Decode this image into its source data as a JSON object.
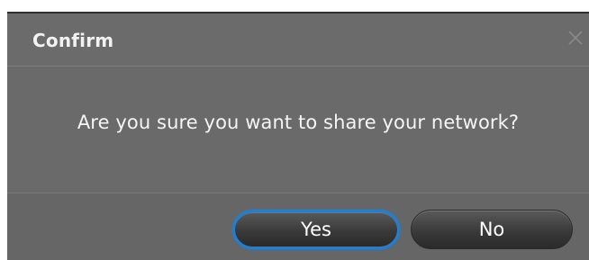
{
  "dialog": {
    "title": "Confirm",
    "close_icon": "close-icon",
    "message": "Are you sure you want to share your network?",
    "buttons": {
      "yes_label": "Yes",
      "no_label": "No"
    },
    "colors": {
      "background": "#6e6e6e",
      "focus_ring": "#1f7fd4",
      "button": "#3a3a3a",
      "text": "#f5f5f5"
    }
  }
}
